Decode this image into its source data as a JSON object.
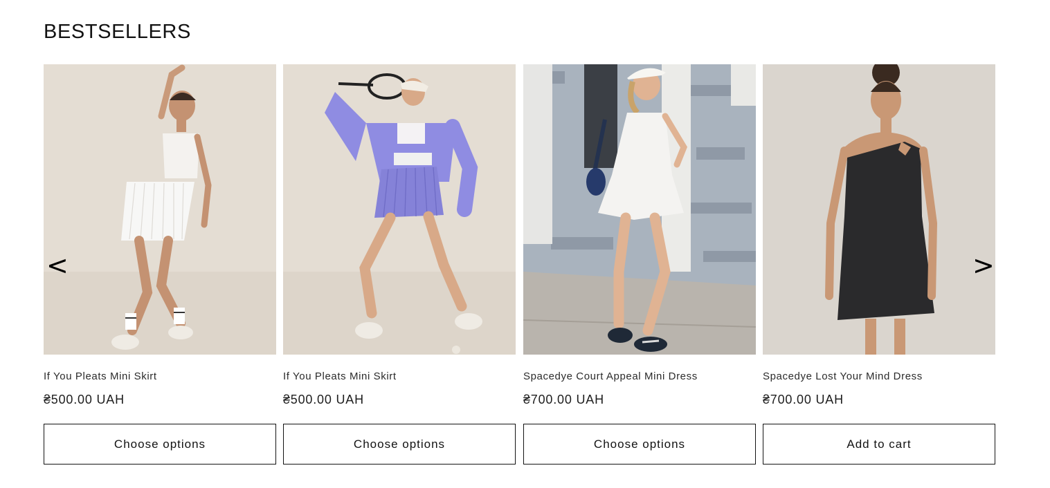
{
  "section": {
    "title": "BESTSELLERS"
  },
  "carousel": {
    "prev_icon": "<",
    "next_icon": ">"
  },
  "products": [
    {
      "title": "If You Pleats Mini Skirt",
      "price": "₴500.00 UAH",
      "button": "Choose options",
      "image": "woman-in-white-pleated-skirt-photo"
    },
    {
      "title": "If You Pleats Mini Skirt",
      "price": "₴500.00 UAH",
      "button": "Choose options",
      "image": "woman-with-tennis-racket-purple-outfit-photo"
    },
    {
      "title": "Spacedye Court Appeal Mini Dress",
      "price": "₴700.00 UAH",
      "button": "Choose options",
      "image": "woman-in-white-mini-dress-street-photo"
    },
    {
      "title": "Spacedye Lost Your Mind Dress",
      "price": "₴700.00 UAH",
      "button": "Add to cart",
      "image": "woman-in-black-one-shoulder-dress-photo"
    }
  ],
  "colors": {
    "text": "#121212",
    "border": "#121212",
    "background": "#ffffff"
  }
}
